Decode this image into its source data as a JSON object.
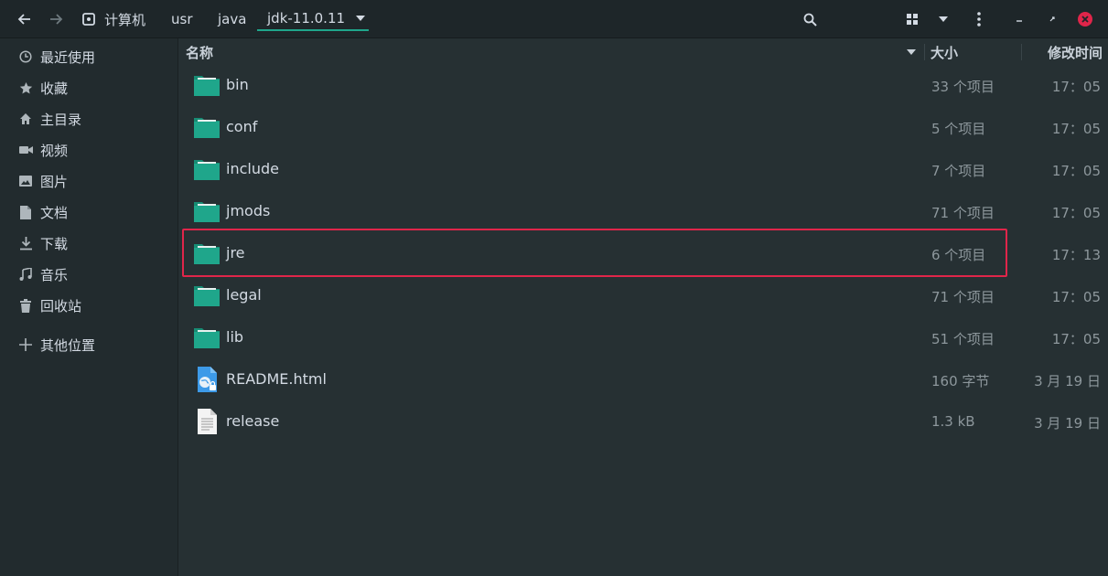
{
  "header": {
    "back_icon": "arrow-left-icon",
    "forward_icon": "arrow-right-icon",
    "breadcrumbs": [
      {
        "label": "计算机",
        "icon": "drive-icon"
      },
      {
        "label": "usr"
      },
      {
        "label": "java"
      },
      {
        "label": "jdk-11.0.11",
        "active": true
      }
    ],
    "accent": "#1fa68b"
  },
  "sidebar": {
    "items": [
      {
        "label": "最近使用",
        "icon": "clock-icon"
      },
      {
        "label": "收藏",
        "icon": "star-icon"
      },
      {
        "label": "主目录",
        "icon": "home-icon"
      },
      {
        "label": "视频",
        "icon": "video-icon"
      },
      {
        "label": "图片",
        "icon": "image-icon"
      },
      {
        "label": "文档",
        "icon": "document-icon"
      },
      {
        "label": "下载",
        "icon": "download-icon"
      },
      {
        "label": "音乐",
        "icon": "music-icon"
      },
      {
        "label": "回收站",
        "icon": "trash-icon"
      },
      {
        "label": "其他位置",
        "icon": "plus-icon"
      }
    ]
  },
  "columns": {
    "name": "名称",
    "size": "大小",
    "modified": "修改时间"
  },
  "files": [
    {
      "name": "bin",
      "type": "folder",
      "size": "33 个项目",
      "modified": "17：05"
    },
    {
      "name": "conf",
      "type": "folder",
      "size": "5 个项目",
      "modified": "17：05"
    },
    {
      "name": "include",
      "type": "folder",
      "size": "7 个项目",
      "modified": "17：05"
    },
    {
      "name": "jmods",
      "type": "folder",
      "size": "71 个项目",
      "modified": "17：05"
    },
    {
      "name": "jre",
      "type": "folder",
      "size": "6 个项目",
      "modified": "17：13",
      "highlighted": true
    },
    {
      "name": "legal",
      "type": "folder",
      "size": "71 个项目",
      "modified": "17：05"
    },
    {
      "name": "lib",
      "type": "folder",
      "size": "51 个项目",
      "modified": "17：05"
    },
    {
      "name": "README.html",
      "type": "html",
      "size": "160 字节",
      "modified": "3 月 19 日"
    },
    {
      "name": "release",
      "type": "text",
      "size": "1.3 kB",
      "modified": "3 月 19 日"
    }
  ],
  "colors": {
    "folder": "#1fa68b",
    "highlight_border": "#e0254a",
    "close_button": "#e0254a"
  }
}
